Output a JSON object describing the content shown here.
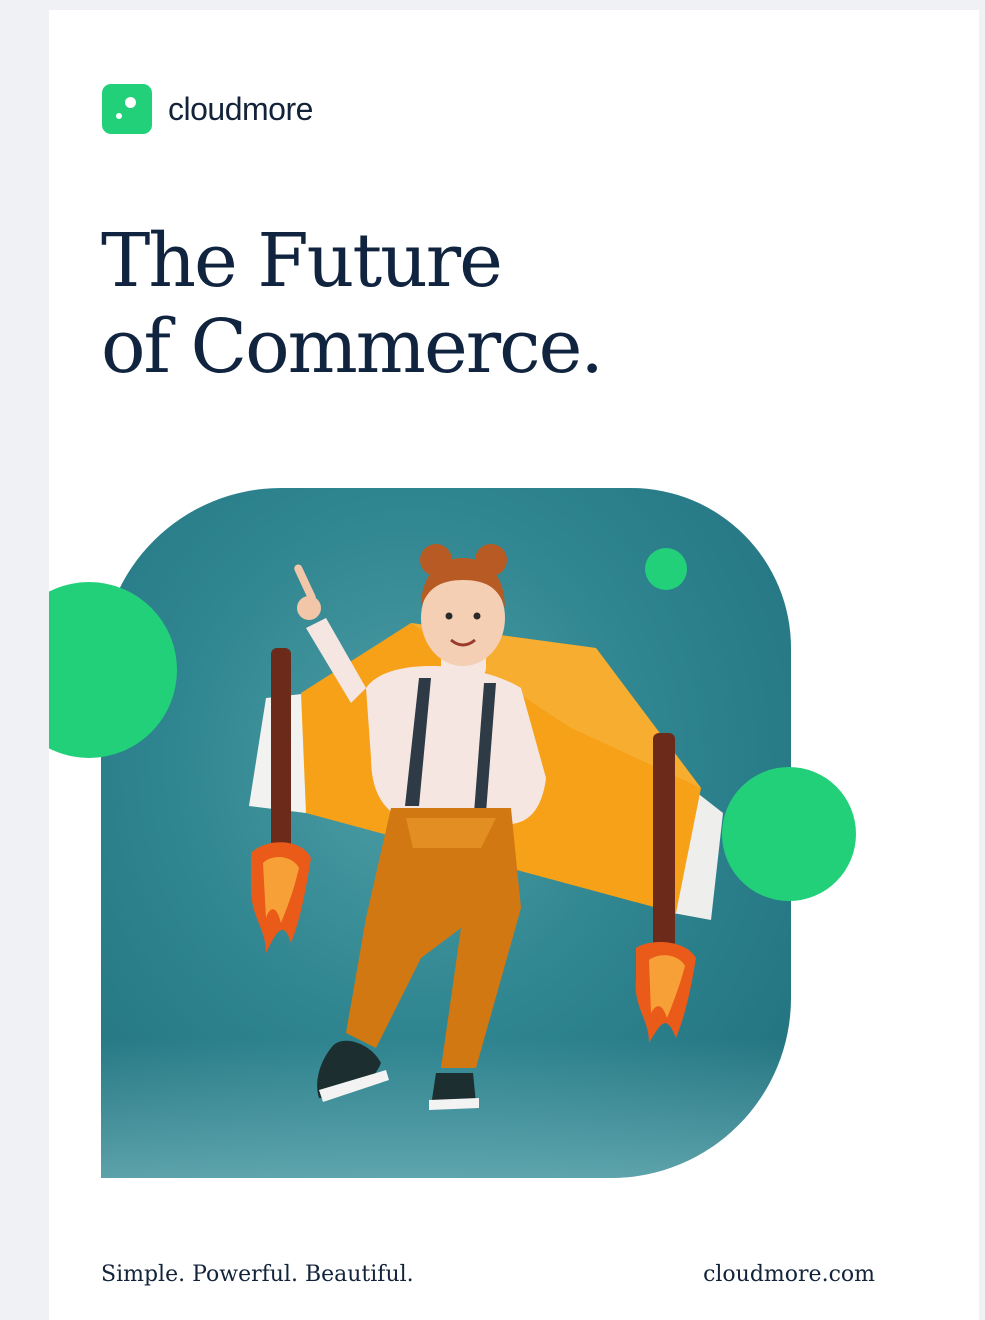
{
  "brand": {
    "name": "cloudmore",
    "color": "#23d07a",
    "logo_icon": "cloudmore-logo-icon"
  },
  "headline": {
    "line1": "The Future",
    "line2": "of Commerce."
  },
  "hero": {
    "image": "girl-with-cardboard-rocket-wings-photo",
    "background_color": "#2f8590"
  },
  "footer": {
    "tagline": "Simple. Powerful. Beautiful.",
    "url": "cloudmore.com"
  }
}
